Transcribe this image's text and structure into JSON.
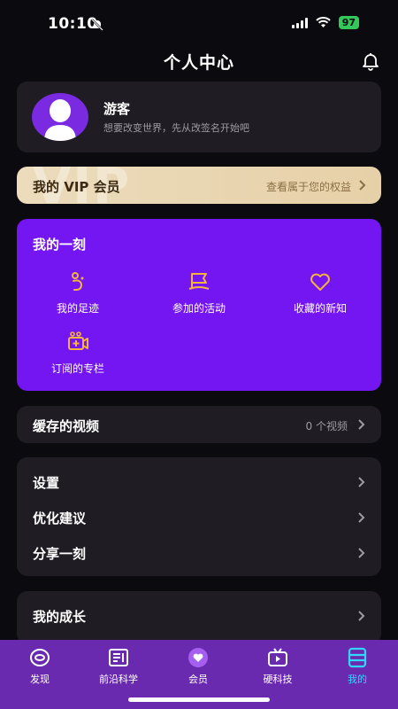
{
  "status": {
    "time": "10:10",
    "battery": "97"
  },
  "header": {
    "title": "个人中心"
  },
  "profile": {
    "username": "游客",
    "signature": "想要改变世界，先从改签名开始吧"
  },
  "vip": {
    "watermark": "VIP",
    "title": "我的 VIP 会员",
    "link": "查看属于您的权益"
  },
  "moment": {
    "title": "我的一刻",
    "items": [
      {
        "label": "我的足迹",
        "icon": "footprint-icon"
      },
      {
        "label": "参加的活动",
        "icon": "flag-icon"
      },
      {
        "label": "收藏的新知",
        "icon": "heart-icon"
      },
      {
        "label": "订阅的专栏",
        "icon": "video-add-icon"
      }
    ]
  },
  "cache": {
    "label": "缓存的视频",
    "value": "0 个视频"
  },
  "settings": {
    "items": [
      "设置",
      "优化建议",
      "分享一刻"
    ]
  },
  "growth": {
    "label": "我的成长"
  },
  "tabs": [
    {
      "label": "发现",
      "icon": "discover-icon"
    },
    {
      "label": "前沿科学",
      "icon": "science-icon"
    },
    {
      "label": "会员",
      "icon": "member-icon"
    },
    {
      "label": "硬科技",
      "icon": "tech-tv-icon"
    },
    {
      "label": "我的",
      "icon": "profile-tab-icon",
      "active": true
    }
  ],
  "colors": {
    "accent_purple": "#7416f2",
    "tab_active": "#33d6ff",
    "icon_gold": "#f3b33d",
    "vip_gold": "#ecdcbc"
  }
}
